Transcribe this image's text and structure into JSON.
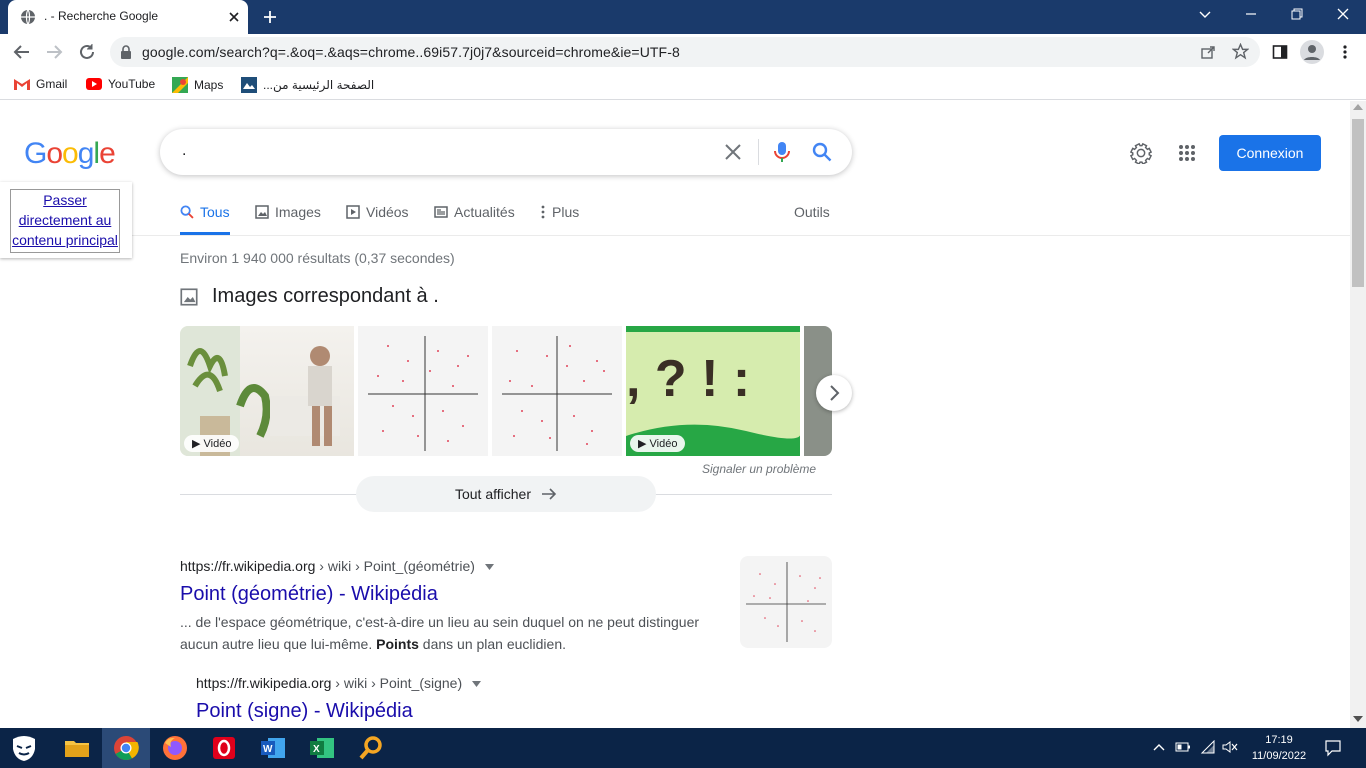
{
  "browser": {
    "tab_title": ". - Recherche Google",
    "url": "google.com/search?q=.&oq=.&aqs=chrome..69i57.7j0j7&sourceid=chrome&ie=UTF-8",
    "bookmarks": [
      {
        "label": "Gmail",
        "icon": "gmail-icon"
      },
      {
        "label": "YouTube",
        "icon": "youtube-icon"
      },
      {
        "label": "Maps",
        "icon": "maps-icon"
      },
      {
        "label": "الصفحة الرئيسية من...",
        "icon": "site-icon"
      }
    ]
  },
  "google": {
    "logo": "Google",
    "search_value": ".",
    "signin_label": "Connexion",
    "skip_link": "Passer directement au contenu principal",
    "tabs": [
      {
        "label": "Tous",
        "active": true
      },
      {
        "label": "Images",
        "active": false
      },
      {
        "label": "Vidéos",
        "active": false
      },
      {
        "label": "Actualités",
        "active": false
      },
      {
        "label": "Plus",
        "active": false
      }
    ],
    "tools_label": "Outils",
    "stats": "Environ 1 940 000 résultats (0,37 secondes)",
    "images_heading": "Images correspondant à .",
    "video_badge": "Vidéo",
    "report_label": "Signaler un problème",
    "show_all_label": "Tout afficher",
    "results": [
      {
        "site": "https://fr.wikipedia.org",
        "crumb": " › wiki › Point_(géométrie)",
        "title": "Point (géométrie) - Wikipédia",
        "snippet_pre": "... de l'espace géométrique, c'est-à-dire un lieu au sein duquel on ne peut distinguer aucun autre lieu que lui-même. ",
        "snippet_bold": "Points",
        "snippet_post": " dans un plan euclidien."
      },
      {
        "site": "https://fr.wikipedia.org",
        "crumb": " › wiki › Point_(signe)",
        "title": "Point (signe) - Wikipédia"
      }
    ]
  },
  "taskbar": {
    "time": "17:19",
    "date": "11/09/2022"
  },
  "colors": {
    "accent": "#1a73e8",
    "link": "#1a0dab",
    "titlebar": "#1a3a6b",
    "taskbar": "#0b2447"
  }
}
